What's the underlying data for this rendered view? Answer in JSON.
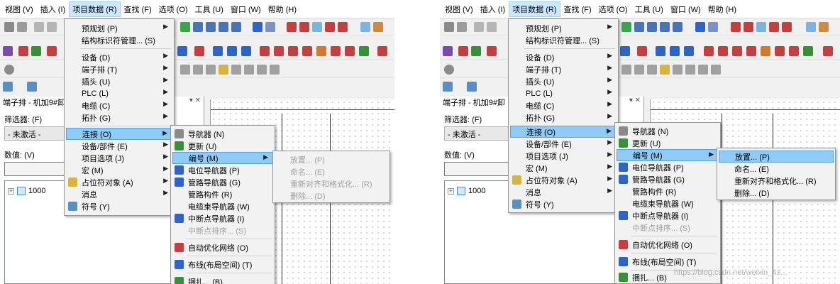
{
  "menubar": {
    "left": [
      {
        "label": "视图 (V)"
      },
      {
        "label": "插入 (I)"
      },
      {
        "label": "项目数据 (R)"
      },
      {
        "label": "查找 (F)"
      },
      {
        "label": "选项 (O)"
      },
      {
        "label": "工具 (U)"
      },
      {
        "label": "窗口 (W)"
      },
      {
        "label": "帮助 (H)"
      }
    ],
    "right": [
      {
        "label": "视图 (V)"
      },
      {
        "label": "插入 (I)"
      },
      {
        "label": "项目数据 (R)"
      },
      {
        "label": "查找 (F)"
      },
      {
        "label": "选项 (O)"
      },
      {
        "label": "工具 (U)"
      },
      {
        "label": "窗口 (W)"
      },
      {
        "label": "帮助 (H)"
      }
    ]
  },
  "panel": {
    "title_left": "端子排 - 机加9#卸",
    "title_right": "端子排 - 机加9#卸",
    "controls": "▾ ✕",
    "filter_label": "筛选器: (F)",
    "filter_value": "- 未激活 -",
    "value_label": "数值: (V)",
    "tree_item": "1000",
    "expander": "+"
  },
  "project_menu": [
    {
      "label": "预规划 (P)",
      "arrow": "▶"
    },
    {
      "label": "结构标识符管理... (S)"
    },
    {
      "label": "设备 (D)",
      "arrow": "▶"
    },
    {
      "label": "端子排 (T)",
      "arrow": "▶"
    },
    {
      "label": "插头 (U)",
      "arrow": "▶"
    },
    {
      "label": "PLC (L)",
      "arrow": "▶"
    },
    {
      "label": "电缆 (C)",
      "arrow": "▶"
    },
    {
      "label": "拓扑 (G)",
      "arrow": "▶"
    },
    {
      "label": "连接 (O)",
      "arrow": "▶"
    },
    {
      "label": "设备/部件 (E)",
      "arrow": "▶"
    },
    {
      "label": "项目选项 (J)",
      "arrow": "▶"
    },
    {
      "label": "宏 (M)",
      "arrow": "▶"
    },
    {
      "label": "占位符对象 (A)",
      "arrow": "▶"
    },
    {
      "label": "消息",
      "arrow": "▶"
    },
    {
      "label": "符号 (Y)"
    }
  ],
  "connection_menu": [
    {
      "label": "导航器 (N)"
    },
    {
      "label": "更新 (U)"
    },
    {
      "label": "编号 (M)",
      "arrow": "▶"
    },
    {
      "label": "电位导航器 (P)"
    },
    {
      "label": "管路导航器 (G)"
    },
    {
      "label": "管路构件 (R)"
    },
    {
      "label": "电缆束导航器 (W)"
    },
    {
      "label": "中断点导航器 (I)"
    },
    {
      "label": "中断点排序... (S)"
    },
    {
      "label": "自动优化网络 (O)"
    },
    {
      "label": "布线(布局空间) (T)"
    },
    {
      "label": "捆扎... (B)"
    }
  ],
  "numbering_menu": [
    {
      "label": "放置... (P)"
    },
    {
      "label": "命名... (E)"
    },
    {
      "label": "重新对齐和格式化... (R)"
    },
    {
      "label": "删除... (D)"
    }
  ],
  "watermark": "https://blog.csdn.net/weixin_43..."
}
